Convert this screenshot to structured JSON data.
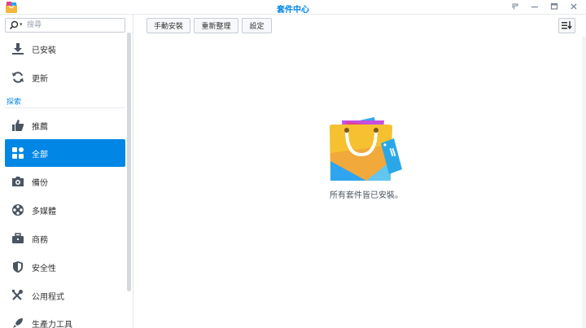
{
  "window": {
    "title": "套件中心"
  },
  "search": {
    "placeholder": "搜尋"
  },
  "sidebar": {
    "section_label": "探索",
    "items": [
      {
        "key": "installed",
        "label": "已安裝",
        "icon": "download-icon"
      },
      {
        "key": "update",
        "label": "更新",
        "icon": "refresh-icon"
      },
      {
        "key": "recommended",
        "label": "推薦",
        "icon": "thumbs-up-icon"
      },
      {
        "key": "all",
        "label": "全部",
        "icon": "grid-icon"
      },
      {
        "key": "backup",
        "label": "備份",
        "icon": "backup-camera-icon"
      },
      {
        "key": "multimedia",
        "label": "多媒體",
        "icon": "film-reel-icon"
      },
      {
        "key": "business",
        "label": "商務",
        "icon": "briefcase-icon"
      },
      {
        "key": "security",
        "label": "安全性",
        "icon": "shield-icon"
      },
      {
        "key": "utilities",
        "label": "公用程式",
        "icon": "tools-icon"
      },
      {
        "key": "productivity",
        "label": "生產力工具",
        "icon": "rocket-icon"
      }
    ],
    "active_key": "all"
  },
  "toolbar": {
    "manual_install_label": "手動安裝",
    "refresh_label": "重新整理",
    "settings_label": "設定"
  },
  "main": {
    "empty_message": "所有套件皆已安裝。",
    "illustration_icon": "package-bag-icon"
  },
  "colors": {
    "accent": "#0086e5",
    "sidebar_icon": "#4b5561"
  }
}
